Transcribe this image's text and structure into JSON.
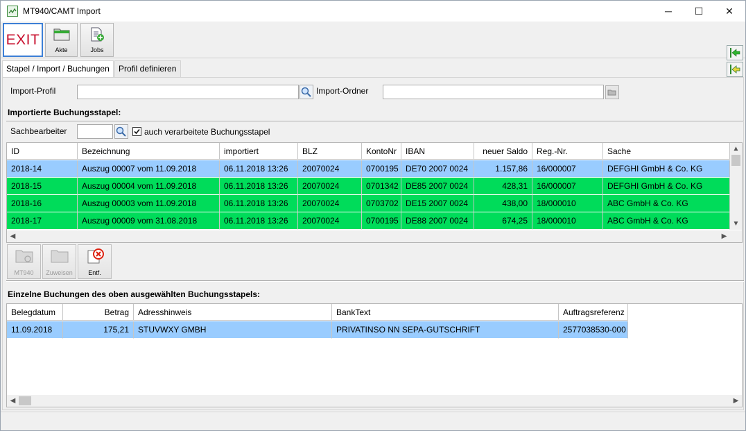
{
  "window": {
    "title": "MT940/CAMT Import",
    "controls": {
      "minimize": "─",
      "maximize": "☐",
      "close": "✕"
    }
  },
  "toolbar": {
    "exit_label": "EXIT",
    "akte_label": "Akte",
    "jobs_label": "Jobs"
  },
  "tabs": [
    {
      "label": "Stapel / Import / Buchungen",
      "active": true
    },
    {
      "label": "Profil definieren",
      "active": false
    }
  ],
  "form": {
    "import_profil_label": "Import-Profil",
    "import_profil_value": "",
    "import_ordner_label": "Import-Ordner",
    "import_ordner_value": "",
    "stapel_heading": "Importierte Buchungsstapel:",
    "sachbearbeiter_label": "Sachbearbeiter",
    "sachbearbeiter_value": "",
    "checkbox_label": "auch verarbeitete Buchungsstapel",
    "checkbox_checked": true
  },
  "stapel_table": {
    "headers": [
      "ID",
      "Bezeichnung",
      "importiert",
      "BLZ",
      "KontoNr",
      "IBAN",
      "neuer Saldo",
      "Reg.-Nr.",
      "Sache"
    ],
    "rows": [
      {
        "status": "selected",
        "cells": [
          "2018-14",
          "Auszug 00007 vom 11.09.2018",
          "06.11.2018  13:26",
          "20070024",
          "0700195",
          "DE70 2007 0024",
          "1.157,86",
          "16/000007",
          "DEFGHI GmbH & Co. KG"
        ]
      },
      {
        "status": "green",
        "cells": [
          "2018-15",
          "Auszug 00004 vom 11.09.2018",
          "06.11.2018  13:26",
          "20070024",
          "0701342",
          "DE85 2007 0024",
          "428,31",
          "16/000007",
          "DEFGHI GmbH & Co. KG"
        ]
      },
      {
        "status": "green",
        "cells": [
          "2018-16",
          "Auszug 00003 vom 11.09.2018",
          "06.11.2018  13:26",
          "20070024",
          "0703702",
          "DE15 2007 0024",
          "438,00",
          "18/000010",
          "ABC GmbH & Co. KG"
        ]
      },
      {
        "status": "green",
        "cells": [
          "2018-17",
          "Auszug 00009 vom 31.08.2018",
          "06.11.2018  13:26",
          "20070024",
          "0700195",
          "DE88 2007 0024",
          "674,25",
          "18/000010",
          "ABC GmbH & Co. KG"
        ]
      }
    ]
  },
  "stapel_buttons": {
    "mt940_label": "MT940",
    "zuweisen_label": "Zuweisen",
    "entf_label": "Entf."
  },
  "buchungen_heading": "Einzelne Buchungen des oben ausgewählten Buchungsstapels:",
  "buchungen_table": {
    "headers": [
      "Belegdatum",
      "Betrag",
      "Adresshinweis",
      "BankText",
      "Auftragsreferenz"
    ],
    "rows": [
      {
        "status": "selected",
        "cells": [
          "11.09.2018",
          "175,21",
          "STUVWXY GMBH",
          "PRIVATINSO NN  SEPA-GUTSCHRIFT",
          "2577038530-000"
        ]
      }
    ]
  },
  "colors": {
    "selected_row": "#99ccff",
    "green_row": "#00dc5a",
    "exit_text": "#c8102e",
    "exit_border": "#3c7fd6"
  }
}
